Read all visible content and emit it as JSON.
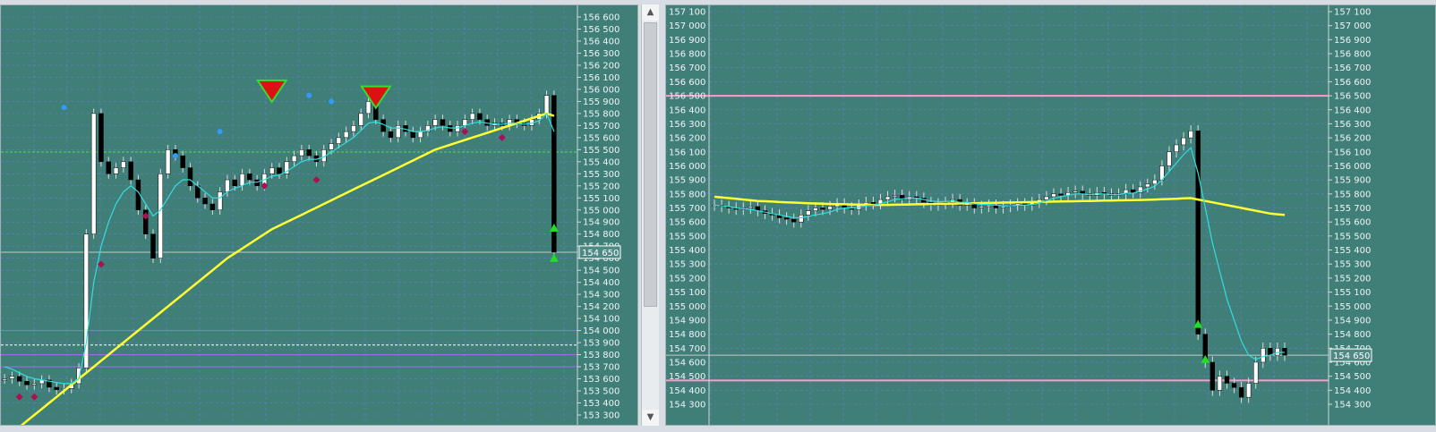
{
  "colors": {
    "background": "#3f7f78",
    "grid": "#6f7fe0",
    "candle_up": "#ffffff",
    "candle_down": "#000000",
    "ma_yellow": "#ffff33",
    "bollinger_blue": "#2a2ac8",
    "envelope_orange": "#d18a3a",
    "ma_cyan": "#33dddd",
    "ma_magenta": "#cc55cc",
    "ma_green": "#33cc55",
    "level_pink": "#ff99cc",
    "level_violet": "#aa66ff"
  },
  "icons": [
    "sell-signal-icon",
    "buy-signal-icon",
    "fractal-down-icon",
    "fractal-up-icon",
    "scroll-up-icon",
    "scroll-down-icon"
  ],
  "scrollbar": {
    "up": "▲",
    "down": "▼"
  },
  "chart_data": [
    {
      "type": "line",
      "id": "left",
      "ylim": [
        153300,
        156600
      ],
      "y_ticks": [
        "156 600",
        "156 500",
        "156 400",
        "156 300",
        "156 200",
        "156 100",
        "156 000",
        "155 900",
        "155 800",
        "155 700",
        "155 600",
        "155 500",
        "155 400",
        "155 300",
        "155 200",
        "155 100",
        "155 000",
        "154 900",
        "154 800",
        "154 700",
        "154 600",
        "154 500",
        "154 400",
        "154 300",
        "154 200",
        "154 100",
        "154 000",
        "153 900",
        "153 800",
        "153 700",
        "153 600",
        "153 500",
        "153 400",
        "153 300"
      ],
      "current_price_label": "154 650",
      "current_price": 154650,
      "horizontal_levels": [
        {
          "value": 155480,
          "style": "green-dotted"
        },
        {
          "value": 154650,
          "style": "grey-solid"
        },
        {
          "value": 154000,
          "style": "violet"
        },
        {
          "value": 153880,
          "style": "white-dotted"
        },
        {
          "value": 153800,
          "style": "violet"
        },
        {
          "value": 153700,
          "style": "violet"
        }
      ],
      "candle_count": 75,
      "close": [
        153600,
        153620,
        153580,
        153550,
        153560,
        153590,
        153530,
        153510,
        153520,
        153560,
        153690,
        154800,
        155800,
        155400,
        155300,
        155350,
        155400,
        155250,
        155000,
        154800,
        154600,
        155300,
        155500,
        155450,
        155350,
        155200,
        155100,
        155050,
        155000,
        155150,
        155250,
        155200,
        155300,
        155250,
        155200,
        155300,
        155350,
        155300,
        155400,
        155450,
        155500,
        155450,
        155400,
        155500,
        155550,
        155600,
        155650,
        155700,
        155800,
        155900,
        155750,
        155650,
        155600,
        155700,
        155650,
        155600,
        155650,
        155700,
        155750,
        155700,
        155650,
        155700,
        155750,
        155800,
        155750,
        155700,
        155720,
        155700,
        155750,
        155720,
        155700,
        155750,
        155800,
        155950,
        154650
      ],
      "series": [
        {
          "name": "",
          "color": "#ffff33",
          "values": [
            153100,
            153150,
            153200,
            153250,
            153300,
            153350,
            153400,
            153450,
            153500,
            153550,
            153600,
            153650,
            153700,
            153750,
            153800,
            153850,
            153900,
            153950,
            154000,
            154050,
            154100,
            154150,
            154200,
            154250,
            154300,
            154350,
            154400,
            154450,
            154500,
            154550,
            154600,
            154640,
            154680,
            154720,
            154760,
            154800,
            154840,
            154870,
            154900,
            154930,
            154960,
            154990,
            155020,
            155050,
            155080,
            155110,
            155140,
            155170,
            155200,
            155230,
            155260,
            155290,
            155320,
            155350,
            155380,
            155410,
            155440,
            155470,
            155500,
            155520,
            155540,
            155560,
            155580,
            155600,
            155620,
            155640,
            155660,
            155680,
            155700,
            155720,
            155740,
            155760,
            155780,
            155800,
            155780
          ]
        },
        {
          "name": "",
          "color": "#33dddd",
          "values": [
            153700,
            153680,
            153650,
            153620,
            153600,
            153590,
            153580,
            153570,
            153560,
            153560,
            153600,
            153900,
            154400,
            154700,
            154900,
            155050,
            155150,
            155200,
            155150,
            155050,
            154950,
            155000,
            155100,
            155200,
            155250,
            155250,
            155200,
            155150,
            155100,
            155100,
            155150,
            155180,
            155200,
            155230,
            155230,
            155250,
            155280,
            155290,
            155320,
            155360,
            155400,
            155420,
            155420,
            155440,
            155480,
            155520,
            155560,
            155600,
            155660,
            155720,
            155730,
            155710,
            155680,
            155680,
            155670,
            155650,
            155650,
            155660,
            155680,
            155690,
            155680,
            155680,
            155700,
            155720,
            155730,
            155720,
            155710,
            155710,
            155720,
            155720,
            155710,
            155720,
            155740,
            155800,
            155650
          ]
        }
      ]
    },
    {
      "type": "line",
      "id": "right",
      "ylim": [
        154300,
        157100
      ],
      "y_ticks": [
        "157 100",
        "157 000",
        "156 900",
        "156 800",
        "156 700",
        "156 600",
        "156 500",
        "156 400",
        "156 300",
        "156 200",
        "156 100",
        "156 000",
        "155 900",
        "155 800",
        "155 700",
        "155 600",
        "155 500",
        "155 400",
        "155 300",
        "155 200",
        "155 100",
        "155 000",
        "154 900",
        "154 800",
        "154 700",
        "154 600",
        "154 500",
        "154 400",
        "154 300"
      ],
      "current_price_label": "154 650",
      "current_price": 154650,
      "horizontal_levels": [
        {
          "value": 156500,
          "style": "pink"
        },
        {
          "value": 154650,
          "style": "grey-solid"
        },
        {
          "value": 154470,
          "style": "pink"
        }
      ],
      "candle_count": 80,
      "close": [
        155720,
        155710,
        155700,
        155690,
        155700,
        155710,
        155680,
        155660,
        155650,
        155630,
        155620,
        155600,
        155650,
        155680,
        155700,
        155690,
        155710,
        155730,
        155700,
        155690,
        155720,
        155740,
        155730,
        155760,
        155780,
        155790,
        155760,
        155780,
        155770,
        155740,
        155720,
        155730,
        155740,
        155760,
        155720,
        155730,
        155700,
        155710,
        155720,
        155700,
        155710,
        155720,
        155730,
        155720,
        155740,
        155760,
        155780,
        155800,
        155790,
        155810,
        155820,
        155800,
        155790,
        155810,
        155800,
        155790,
        155800,
        155830,
        155810,
        155850,
        155870,
        155900,
        156000,
        156100,
        156150,
        156200,
        156250,
        154800,
        154600,
        154400,
        154500,
        154450,
        154420,
        154350,
        154450,
        154600,
        154700,
        154650,
        154700,
        154650
      ],
      "series": [
        {
          "name": "",
          "color": "#ffff33",
          "values": [
            155780,
            155775,
            155770,
            155765,
            155760,
            155755,
            155750,
            155748,
            155745,
            155742,
            155740,
            155738,
            155736,
            155734,
            155732,
            155730,
            155728,
            155727,
            155726,
            155725,
            155724,
            155723,
            155722,
            155722,
            155722,
            155723,
            155724,
            155725,
            155726,
            155727,
            155728,
            155729,
            155730,
            155731,
            155732,
            155733,
            155734,
            155735,
            155736,
            155737,
            155738,
            155739,
            155740,
            155741,
            155742,
            155743,
            155744,
            155745,
            155746,
            155747,
            155748,
            155749,
            155750,
            155751,
            155752,
            155753,
            155754,
            155755,
            155756,
            155757,
            155758,
            155760,
            155762,
            155764,
            155766,
            155768,
            155770,
            155760,
            155750,
            155740,
            155730,
            155720,
            155710,
            155700,
            155690,
            155680,
            155670,
            155660,
            155655,
            155650
          ]
        },
        {
          "name": "",
          "color": "#33dddd",
          "values": [
            155720,
            155715,
            155710,
            155700,
            155695,
            155690,
            155680,
            155670,
            155660,
            155650,
            155640,
            155630,
            155630,
            155640,
            155650,
            155660,
            155670,
            155690,
            155700,
            155700,
            155705,
            155715,
            155720,
            155730,
            155745,
            155760,
            155765,
            155770,
            155770,
            155760,
            155750,
            155745,
            155745,
            155750,
            155740,
            155740,
            155730,
            155725,
            155725,
            155720,
            155715,
            155715,
            155720,
            155720,
            155725,
            155735,
            155750,
            155770,
            155780,
            155790,
            155800,
            155800,
            155795,
            155800,
            155800,
            155795,
            155795,
            155805,
            155805,
            155820,
            155835,
            155855,
            155900,
            155960,
            156020,
            156080,
            156130,
            155950,
            155700,
            155450,
            155250,
            155050,
            154900,
            154750,
            154650,
            154620,
            154640,
            154650,
            154670,
            154670
          ]
        }
      ]
    }
  ]
}
